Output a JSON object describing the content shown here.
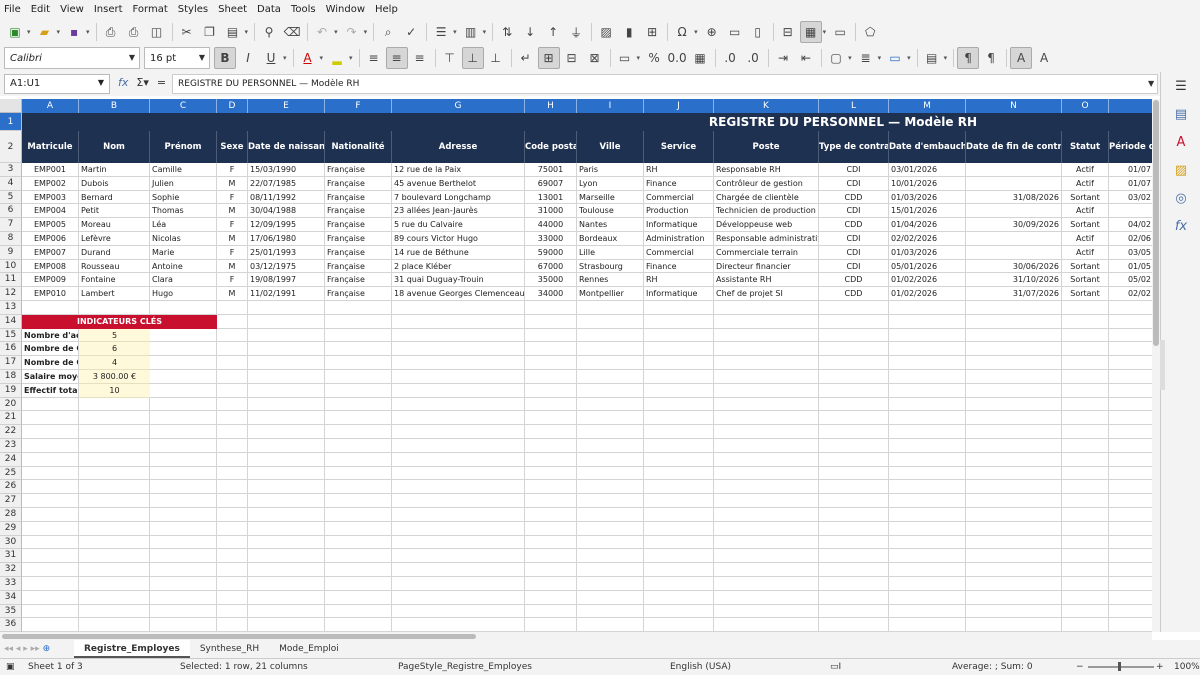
{
  "menu": [
    "File",
    "Edit",
    "View",
    "Insert",
    "Format",
    "Styles",
    "Sheet",
    "Data",
    "Tools",
    "Window",
    "Help"
  ],
  "toolbar": {
    "font_name": "Calibri",
    "font_size": "16 pt"
  },
  "formula_bar": {
    "name_box": "A1:U1",
    "content": "REGISTRE DU PERSONNEL — Modèle RH"
  },
  "columns": [
    "A",
    "B",
    "C",
    "D",
    "E",
    "F",
    "G",
    "H",
    "I",
    "J",
    "K",
    "L",
    "M",
    "N",
    "O"
  ],
  "rows": [
    "1",
    "2",
    "3",
    "4",
    "5",
    "6",
    "7",
    "8",
    "9",
    "10",
    "11",
    "12",
    "13",
    "14",
    "15",
    "16",
    "17",
    "18",
    "19",
    "20",
    "21",
    "22",
    "23",
    "24",
    "25",
    "26",
    "27",
    "28",
    "29",
    "30",
    "31",
    "32",
    "33",
    "34",
    "35",
    "36"
  ],
  "title": "REGISTRE DU PERSONNEL — Modèle RH",
  "headers": [
    "Matricule",
    "Nom",
    "Prénom",
    "Sexe",
    "Date de naissance",
    "Nationalité",
    "Adresse",
    "Code postal",
    "Ville",
    "Service",
    "Poste",
    "Type de contrat",
    "Date d'embauche",
    "Date de fin de contrat",
    "Statut",
    "Période d"
  ],
  "employees": [
    [
      "EMP001",
      "Martin",
      "Camille",
      "F",
      "15/03/1990",
      "Française",
      "12 rue de la Paix",
      "75001",
      "Paris",
      "RH",
      "Responsable RH",
      "CDI",
      "03/01/2026",
      "",
      "Actif",
      "01/07"
    ],
    [
      "EMP002",
      "Dubois",
      "Julien",
      "M",
      "22/07/1985",
      "Française",
      "45 avenue Berthelot",
      "69007",
      "Lyon",
      "Finance",
      "Contrôleur de gestion",
      "CDI",
      "10/01/2026",
      "",
      "Actif",
      "01/07"
    ],
    [
      "EMP003",
      "Bernard",
      "Sophie",
      "F",
      "08/11/1992",
      "Française",
      "7 boulevard Longchamp",
      "13001",
      "Marseille",
      "Commercial",
      "Chargée de clientèle",
      "CDD",
      "01/03/2026",
      "31/08/2026",
      "Sortant",
      "03/02"
    ],
    [
      "EMP004",
      "Petit",
      "Thomas",
      "M",
      "30/04/1988",
      "Française",
      "23 allées Jean-Jaurès",
      "31000",
      "Toulouse",
      "Production",
      "Technicien de production",
      "CDI",
      "15/01/2026",
      "",
      "Actif",
      ""
    ],
    [
      "EMP005",
      "Moreau",
      "Léa",
      "F",
      "12/09/1995",
      "Française",
      "5 rue du Calvaire",
      "44000",
      "Nantes",
      "Informatique",
      "Développeuse web",
      "CDD",
      "01/04/2026",
      "30/09/2026",
      "Sortant",
      "04/02"
    ],
    [
      "EMP006",
      "Lefèvre",
      "Nicolas",
      "M",
      "17/06/1980",
      "Française",
      "89 cours Victor Hugo",
      "33000",
      "Bordeaux",
      "Administration",
      "Responsable administratif",
      "CDI",
      "02/02/2026",
      "",
      "Actif",
      "02/06"
    ],
    [
      "EMP007",
      "Durand",
      "Marie",
      "F",
      "25/01/1993",
      "Française",
      "14 rue de Béthune",
      "59000",
      "Lille",
      "Commercial",
      "Commerciale terrain",
      "CDI",
      "01/03/2026",
      "",
      "Actif",
      "03/05"
    ],
    [
      "EMP008",
      "Rousseau",
      "Antoine",
      "M",
      "03/12/1975",
      "Française",
      "2 place Kléber",
      "67000",
      "Strasbourg",
      "Finance",
      "Directeur financier",
      "CDI",
      "05/01/2026",
      "30/06/2026",
      "Sortant",
      "01/05"
    ],
    [
      "EMP009",
      "Fontaine",
      "Clara",
      "F",
      "19/08/1997",
      "Française",
      "31 quai Duguay-Trouin",
      "35000",
      "Rennes",
      "RH",
      "Assistante RH",
      "CDD",
      "01/02/2026",
      "31/10/2026",
      "Sortant",
      "05/02"
    ],
    [
      "EMP010",
      "Lambert",
      "Hugo",
      "M",
      "11/02/1991",
      "Française",
      "18 avenue Georges Clemenceau",
      "34000",
      "Montpellier",
      "Informatique",
      "Chef de projet SI",
      "CDD",
      "01/02/2026",
      "31/07/2026",
      "Sortant",
      "02/02"
    ]
  ],
  "kpi": {
    "title": "INDICATEURS CLÉS",
    "items": [
      {
        "label": "Nombre d'actifs",
        "value": "5"
      },
      {
        "label": "Nombre de CDI",
        "value": "6"
      },
      {
        "label": "Nombre de CDD",
        "value": "4"
      },
      {
        "label": "Salaire moyen (€)",
        "value": "3 800.00 €"
      },
      {
        "label": "Effectif total",
        "value": "10"
      }
    ]
  },
  "sheets": [
    "Registre_Employes",
    "Synthese_RH",
    "Mode_Emploi"
  ],
  "status": {
    "sheet": "Sheet 1 of 3",
    "selection": "Selected: 1 row, 21 columns",
    "page_style": "PageStyle_Registre_Employes",
    "language": "English (USA)",
    "summary": "Average: ; Sum: 0",
    "zoom": "100%"
  },
  "colors": {
    "header_bg": "#1f3150",
    "col_header_bg": "#2a6fc9",
    "kpi_bg": "#c8102e",
    "kpi_value_bg": "#fff9dc"
  }
}
